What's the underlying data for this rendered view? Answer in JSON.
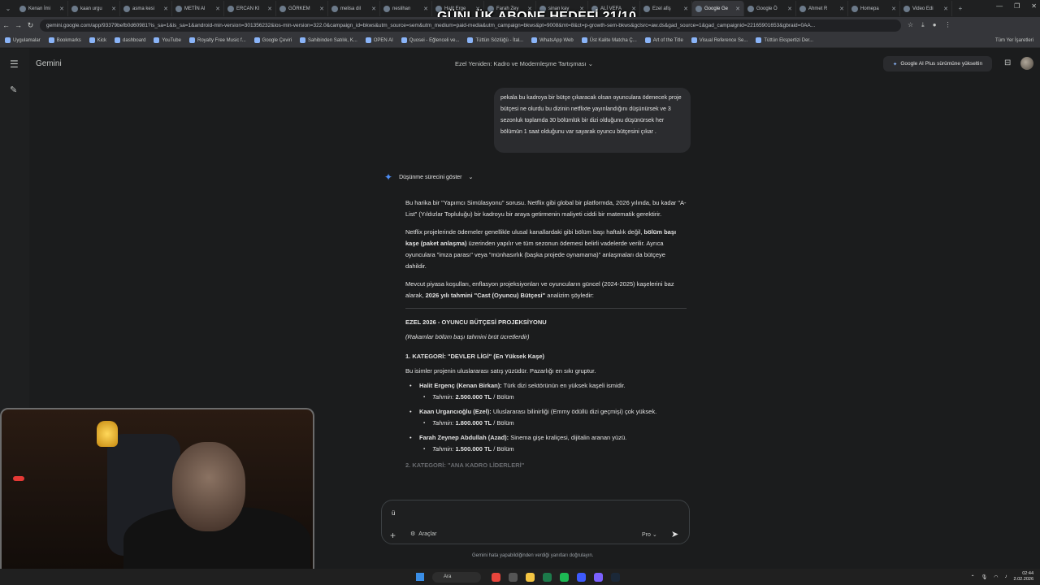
{
  "overlay": {
    "title": "GÜNLÜK ABONE HEDEFİ 21/10"
  },
  "browser": {
    "tabs": [
      {
        "label": "Kenan İmi"
      },
      {
        "label": "kaan urgu"
      },
      {
        "label": "asma kesi"
      },
      {
        "label": "METİN Al"
      },
      {
        "label": "ERCAN KI"
      },
      {
        "label": "GÖRKEM"
      },
      {
        "label": "melisa dil"
      },
      {
        "label": "neslihan"
      },
      {
        "label": "Halit Erge"
      },
      {
        "label": "Farah Zey"
      },
      {
        "label": "sinan kay"
      },
      {
        "label": "ALİ VEFA"
      },
      {
        "label": "Ezel afiş"
      },
      {
        "label": "Google Ge"
      },
      {
        "label": "Google Ö"
      },
      {
        "label": "Ahmet R"
      },
      {
        "label": "Homepa"
      },
      {
        "label": "Video Edi"
      }
    ],
    "active_tab_index": 13,
    "url": "gemini.google.com/app/93379befb0d60981?is_sa=1&is_sa=1&android-min-version=301356232&ios-min-version=322.0&campaign_id=bkws&utm_source=sem&utm_medium=paid-media&utm_campaign=bkws&pt=9008&mt=8&ct=p-growth-sem-bkws&gclsrc=aw.ds&gad_source=1&gad_campaignid=22165901653&gbraid=0AA...",
    "bookmarks": [
      "Uygulamalar",
      "Bookmarks",
      "Kick",
      "dashboard",
      "YouTube",
      "Royalty Free Music f...",
      "Google Çeviri",
      "Sahibinden Satılık, K...",
      "OPEN AI",
      "Quosei - Eğlenceli ve...",
      "Tüttün Sözlüğü - İtal...",
      "WhatsApp Web",
      "Üst Kalite Matcha Ç...",
      "Art of the Title",
      "Visual Reference Se...",
      "Tüttün Ekspertizi Der..."
    ],
    "bookmarks_right": "Tüm Yer İşaretleri"
  },
  "app": {
    "brand": "Gemini",
    "conversation_title": "Ezel Yeniden: Kadro ve Modernleşme Tartışması",
    "upgrade_label": "Google AI Plus sürümüne yükseltin",
    "user_message": "pekala bu kadroya bir bütçe çıkaracak olsan oyunculara ödenecek proje bütçesi ne olurdu bu dizinin netflixte yayınlandığını düşünürsek ve 3 sezonluk toplamda 30 bölümlük bir dizi olduğunu düşünürsek her bölümün 1 saat olduğunu var sayarak oyuncu bütçesini çıkar .",
    "thinking_label": "Düşünme sürecini göster",
    "response": {
      "p1": "Bu harika bir \"Yapımcı Simülasyonu\" sorusu. Netflix gibi global bir platformda, 2026 yılında, bu kadar \"A-List\" (Yıldızlar Topluluğu) bir kadroyu bir araya getirmenin maliyeti ciddi bir matematik gerektirir.",
      "p2a": "Netflix projelerinde ödemeler genellikle ulusal kanallardaki gibi bölüm başı haftalık değil, ",
      "p2b": "bölüm başı kaşe (paket anlaşma)",
      "p2c": " üzerinden yapılır ve tüm sezonun ödemesi belirli vadelerde verilir. Ayrıca oyunculara \"imza parası\" veya \"münhasırlık (başka projede oynamama)\" anlaşmaları da bütçeye dahildir.",
      "p3a": "Mevcut piyasa koşulları, enflasyon projeksiyonları ve oyuncuların güncel (2024-2025) kaşelerini baz alarak, ",
      "p3b": "2026 yılı tahmini \"Cast (Oyuncu) Bütçesi\"",
      "p3c": " analizim şöyledir:",
      "heading": "EZEL 2026 - OYUNCU BÜTÇESİ PROJEKSİYONU",
      "subheading": "(Rakamlar bölüm başı tahmini brüt ücretlerdir)",
      "cat1": "1. KATEGORİ: \"DEVLER LİGİ\" (En Yüksek Kaşe)",
      "cat1_desc": "Bu isimler projenin uluslararası satış yüzüdür. Pazarlığı en sıkı gruptur.",
      "estimate_label": "Tahmin:",
      "per_episode": " / Bölüm",
      "actors": [
        {
          "name": "Halit Ergenç (Kenan Birkan):",
          "desc": " Türk dizi sektörünün en yüksek kaşeli ismidir.",
          "amount": "2.500.000 TL"
        },
        {
          "name": "Kaan Urgancıoğlu (Ezel):",
          "desc": " Uluslararası bilinirliği (Emmy ödüllü dizi geçmişi) çok yüksek.",
          "amount": "1.800.000 TL"
        },
        {
          "name": "Farah Zeynep Abdullah (Azad):",
          "desc": " Sinema gişe kraliçesi, dijitalin aranan yüzü.",
          "amount": "1.500.000 TL"
        }
      ],
      "cat2": "2. KATEGORİ: \"ANA KADRO LİDERLERİ\""
    },
    "input": {
      "value": "ü",
      "tools_label": "Araçlar",
      "model_label": "Pro"
    },
    "disclaimer": "Gemini hata yapabildiğinden verdiği yanıtları doğrulayın."
  },
  "taskbar": {
    "search_label": "Ara",
    "time": "02:44",
    "date": "2.02.2026"
  }
}
